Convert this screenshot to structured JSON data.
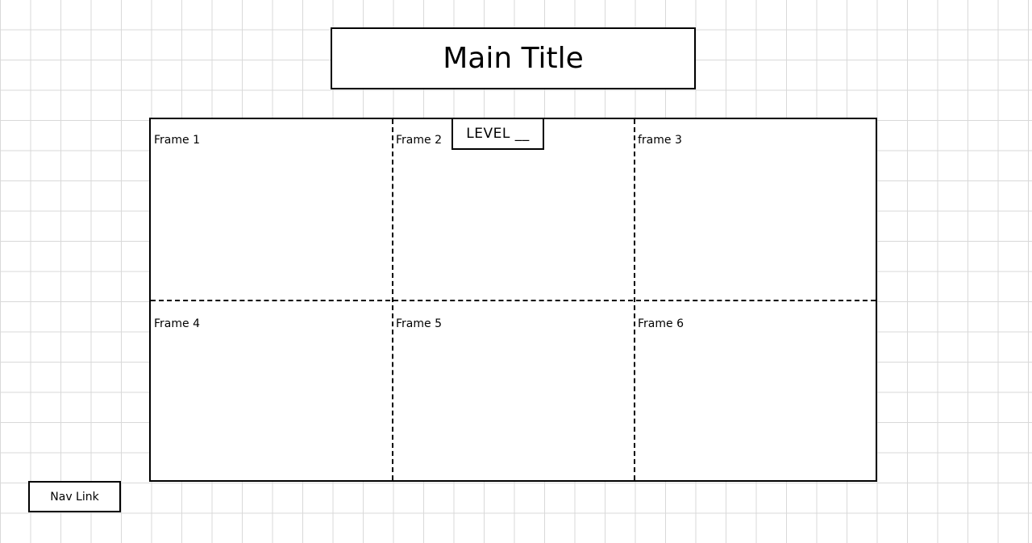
{
  "title": "Main Title",
  "level_label": "LEVEL __",
  "frames": [
    "Frame 1",
    "Frame 2",
    "frame 3",
    "Frame 4",
    "Frame 5",
    "Frame 6"
  ],
  "nav_link": "Nav Link"
}
